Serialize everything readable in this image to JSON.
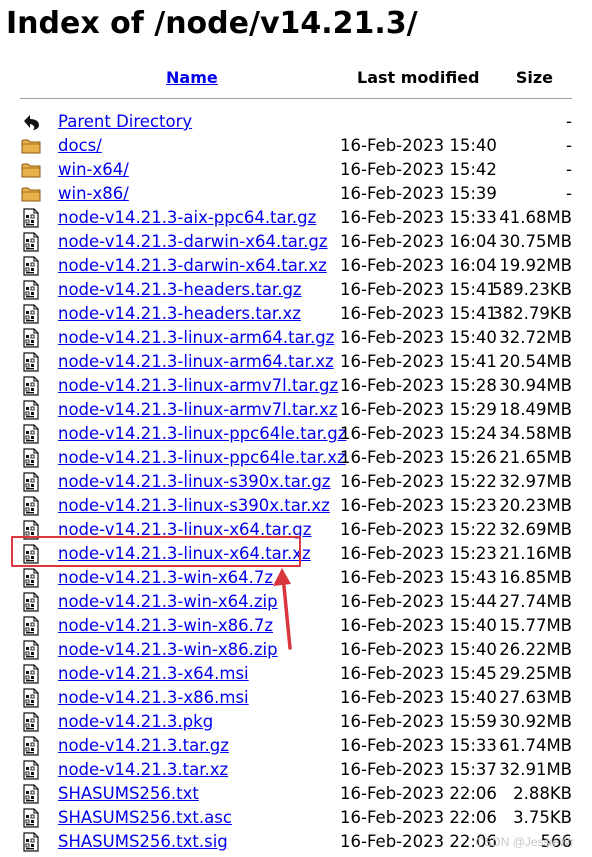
{
  "page": {
    "title": "Index of /node/v14.21.3/",
    "watermark": "CSDN @JessieWr"
  },
  "header": {
    "name": "Name",
    "last_modified": "Last modified",
    "size": "Size"
  },
  "entries": [
    {
      "name": "Parent Directory",
      "modified": "",
      "size": "-",
      "icon": "back-arrow-icon"
    },
    {
      "name": "docs/",
      "modified": "16-Feb-2023 15:40",
      "size": "-",
      "icon": "folder-icon"
    },
    {
      "name": "win-x64/",
      "modified": "16-Feb-2023 15:42",
      "size": "-",
      "icon": "folder-icon"
    },
    {
      "name": "win-x86/",
      "modified": "16-Feb-2023 15:39",
      "size": "-",
      "icon": "folder-icon"
    },
    {
      "name": "node-v14.21.3-aix-ppc64.tar.gz",
      "modified": "16-Feb-2023 15:33",
      "size": "41.68MB",
      "icon": "binary-file-icon"
    },
    {
      "name": "node-v14.21.3-darwin-x64.tar.gz",
      "modified": "16-Feb-2023 16:04",
      "size": "30.75MB",
      "icon": "binary-file-icon"
    },
    {
      "name": "node-v14.21.3-darwin-x64.tar.xz",
      "modified": "16-Feb-2023 16:04",
      "size": "19.92MB",
      "icon": "binary-file-icon"
    },
    {
      "name": "node-v14.21.3-headers.tar.gz",
      "modified": "16-Feb-2023 15:41",
      "size": "589.23KB",
      "icon": "binary-file-icon"
    },
    {
      "name": "node-v14.21.3-headers.tar.xz",
      "modified": "16-Feb-2023 15:41",
      "size": "382.79KB",
      "icon": "binary-file-icon"
    },
    {
      "name": "node-v14.21.3-linux-arm64.tar.gz",
      "modified": "16-Feb-2023 15:40",
      "size": "32.72MB",
      "icon": "binary-file-icon"
    },
    {
      "name": "node-v14.21.3-linux-arm64.tar.xz",
      "modified": "16-Feb-2023 15:41",
      "size": "20.54MB",
      "icon": "binary-file-icon"
    },
    {
      "name": "node-v14.21.3-linux-armv7l.tar.gz",
      "modified": "16-Feb-2023 15:28",
      "size": "30.94MB",
      "icon": "binary-file-icon"
    },
    {
      "name": "node-v14.21.3-linux-armv7l.tar.xz",
      "modified": "16-Feb-2023 15:29",
      "size": "18.49MB",
      "icon": "binary-file-icon"
    },
    {
      "name": "node-v14.21.3-linux-ppc64le.tar.gz",
      "modified": "16-Feb-2023 15:24",
      "size": "34.58MB",
      "icon": "binary-file-icon"
    },
    {
      "name": "node-v14.21.3-linux-ppc64le.tar.xz",
      "modified": "16-Feb-2023 15:26",
      "size": "21.65MB",
      "icon": "binary-file-icon"
    },
    {
      "name": "node-v14.21.3-linux-s390x.tar.gz",
      "modified": "16-Feb-2023 15:22",
      "size": "32.97MB",
      "icon": "binary-file-icon"
    },
    {
      "name": "node-v14.21.3-linux-s390x.tar.xz",
      "modified": "16-Feb-2023 15:23",
      "size": "20.23MB",
      "icon": "binary-file-icon"
    },
    {
      "name": "node-v14.21.3-linux-x64.tar.gz",
      "modified": "16-Feb-2023 15:22",
      "size": "32.69MB",
      "icon": "binary-file-icon"
    },
    {
      "name": "node-v14.21.3-linux-x64.tar.xz",
      "modified": "16-Feb-2023 15:23",
      "size": "21.16MB",
      "icon": "binary-file-icon",
      "highlighted": true
    },
    {
      "name": "node-v14.21.3-win-x64.7z",
      "modified": "16-Feb-2023 15:43",
      "size": "16.85MB",
      "icon": "binary-file-icon"
    },
    {
      "name": "node-v14.21.3-win-x64.zip",
      "modified": "16-Feb-2023 15:44",
      "size": "27.74MB",
      "icon": "binary-file-icon"
    },
    {
      "name": "node-v14.21.3-win-x86.7z",
      "modified": "16-Feb-2023 15:40",
      "size": "15.77MB",
      "icon": "binary-file-icon"
    },
    {
      "name": "node-v14.21.3-win-x86.zip",
      "modified": "16-Feb-2023 15:40",
      "size": "26.22MB",
      "icon": "binary-file-icon"
    },
    {
      "name": "node-v14.21.3-x64.msi",
      "modified": "16-Feb-2023 15:45",
      "size": "29.25MB",
      "icon": "binary-file-icon"
    },
    {
      "name": "node-v14.21.3-x86.msi",
      "modified": "16-Feb-2023 15:40",
      "size": "27.63MB",
      "icon": "binary-file-icon"
    },
    {
      "name": "node-v14.21.3.pkg",
      "modified": "16-Feb-2023 15:59",
      "size": "30.92MB",
      "icon": "binary-file-icon"
    },
    {
      "name": "node-v14.21.3.tar.gz",
      "modified": "16-Feb-2023 15:33",
      "size": "61.74MB",
      "icon": "binary-file-icon"
    },
    {
      "name": "node-v14.21.3.tar.xz",
      "modified": "16-Feb-2023 15:37",
      "size": "32.91MB",
      "icon": "binary-file-icon"
    },
    {
      "name": "SHASUMS256.txt",
      "modified": "16-Feb-2023 22:06",
      "size": "2.88KB",
      "icon": "binary-file-icon"
    },
    {
      "name": "SHASUMS256.txt.asc",
      "modified": "16-Feb-2023 22:06",
      "size": "3.75KB",
      "icon": "binary-file-icon"
    },
    {
      "name": "SHASUMS256.txt.sig",
      "modified": "16-Feb-2023 22:06",
      "size": "566",
      "icon": "binary-file-icon"
    }
  ],
  "colors": {
    "link": "#0000ee",
    "highlight_box": "#d9363e",
    "arrow": "#d9363e",
    "folder": "#e8b04a"
  }
}
